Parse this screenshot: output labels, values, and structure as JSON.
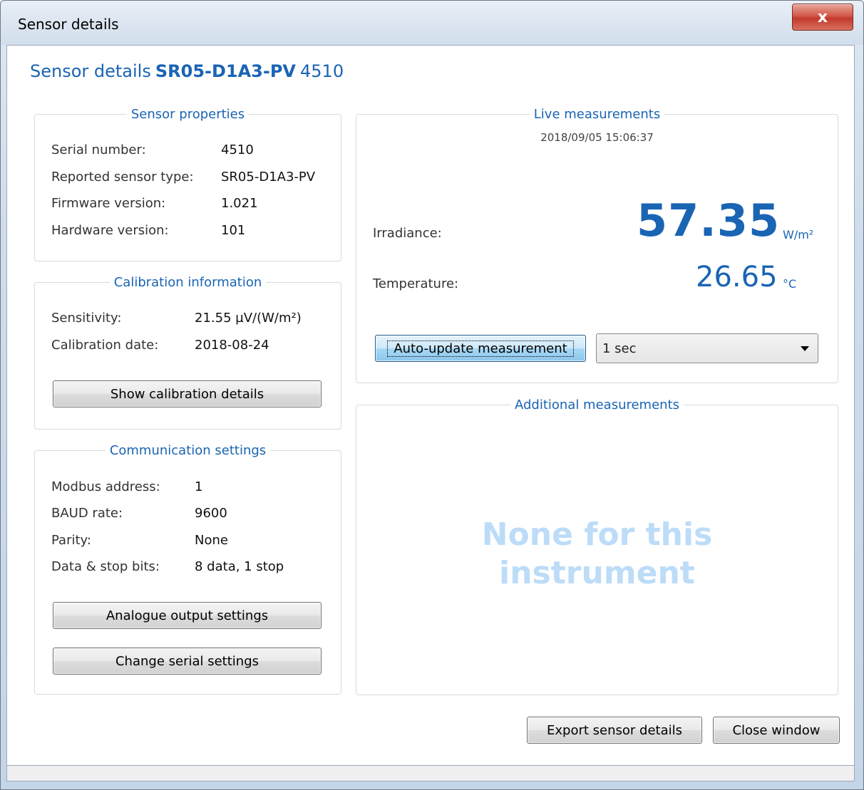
{
  "window": {
    "title": "Sensor details",
    "close_glyph": "x"
  },
  "header": {
    "prefix": "Sensor details",
    "model": "SR05-D1A3-PV",
    "serial": "4510"
  },
  "sensor_properties": {
    "title": "Sensor properties",
    "rows": [
      {
        "label": "Serial number:",
        "value": "4510"
      },
      {
        "label": "Reported sensor type:",
        "value": "SR05-D1A3-PV"
      },
      {
        "label": "Firmware version:",
        "value": "1.021"
      },
      {
        "label": "Hardware version:",
        "value": "101"
      }
    ]
  },
  "calibration": {
    "title": "Calibration information",
    "rows": [
      {
        "label": "Sensitivity:",
        "value": "21.55 µV/(W/m²)"
      },
      {
        "label": "Calibration date:",
        "value": "2018-08-24"
      }
    ],
    "button": "Show calibration details"
  },
  "communication": {
    "title": "Communication settings",
    "rows": [
      {
        "label": "Modbus address:",
        "value": "1"
      },
      {
        "label": "BAUD rate:",
        "value": "9600"
      },
      {
        "label": "Parity:",
        "value": "None"
      },
      {
        "label": "Data & stop bits:",
        "value": "8 data, 1 stop"
      }
    ],
    "button_analogue": "Analogue output settings",
    "button_serial": "Change serial settings"
  },
  "live": {
    "title": "Live measurements",
    "timestamp": "2018/09/05 15:06:37",
    "irradiance_label": "Irradiance:",
    "irradiance_value": "57.35",
    "irradiance_unit": "W/m²",
    "temperature_label": "Temperature:",
    "temperature_value": "26.65",
    "temperature_unit": "°C",
    "auto_update_button": "Auto-update measurement",
    "interval_selected": "1 sec"
  },
  "additional": {
    "title": "Additional measurements",
    "message_line1": "None for this",
    "message_line2": "instrument"
  },
  "footer": {
    "export_button": "Export sensor details",
    "close_button": "Close window"
  },
  "colors": {
    "accent": "#1a64b4",
    "placeholder": "#bcdcf8",
    "close_red": "#c23a2c"
  }
}
